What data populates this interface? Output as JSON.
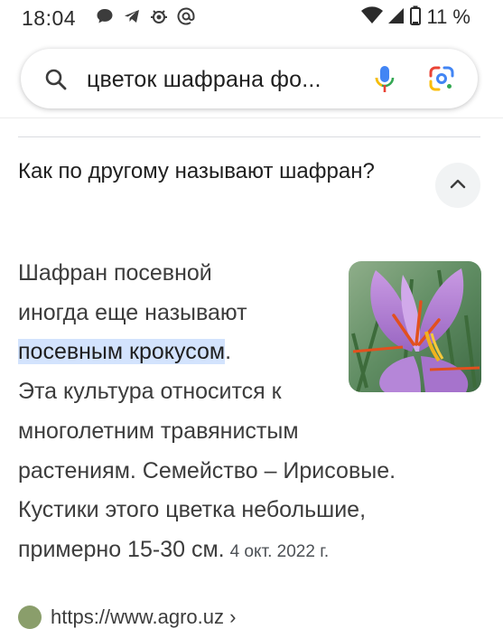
{
  "status_bar": {
    "time": "18:04",
    "battery": "11 %",
    "icons_left": [
      "chat-icon",
      "telegram-icon",
      "bug-icon",
      "at-icon"
    ],
    "icons_right": [
      "wifi-icon",
      "signal-icon",
      "battery-icon"
    ]
  },
  "search": {
    "query": "цветок шафрана фо...",
    "icons": [
      "search-icon",
      "mic-icon",
      "google-lens-icon"
    ]
  },
  "result": {
    "question": "Как по другому называют шафран?",
    "answer_lines": [
      "Шафран посевной",
      "иногда еще называют",
      "посевным крокусом",
      ".",
      "Эта культура относится к",
      "многолетним травянистым",
      "растениям. Семейство – Ирисовые.",
      "Кустики этого цветка небольшие,",
      "примерно 15-30 см."
    ],
    "date": "4 окт. 2022 г.",
    "source_url": "https://www.agro.uz ›",
    "image_name": "saffron-flower-image"
  },
  "colors": {
    "highlight": "#d3e3fd",
    "mic_blue": "#4285f4",
    "mic_red": "#ea4335"
  }
}
